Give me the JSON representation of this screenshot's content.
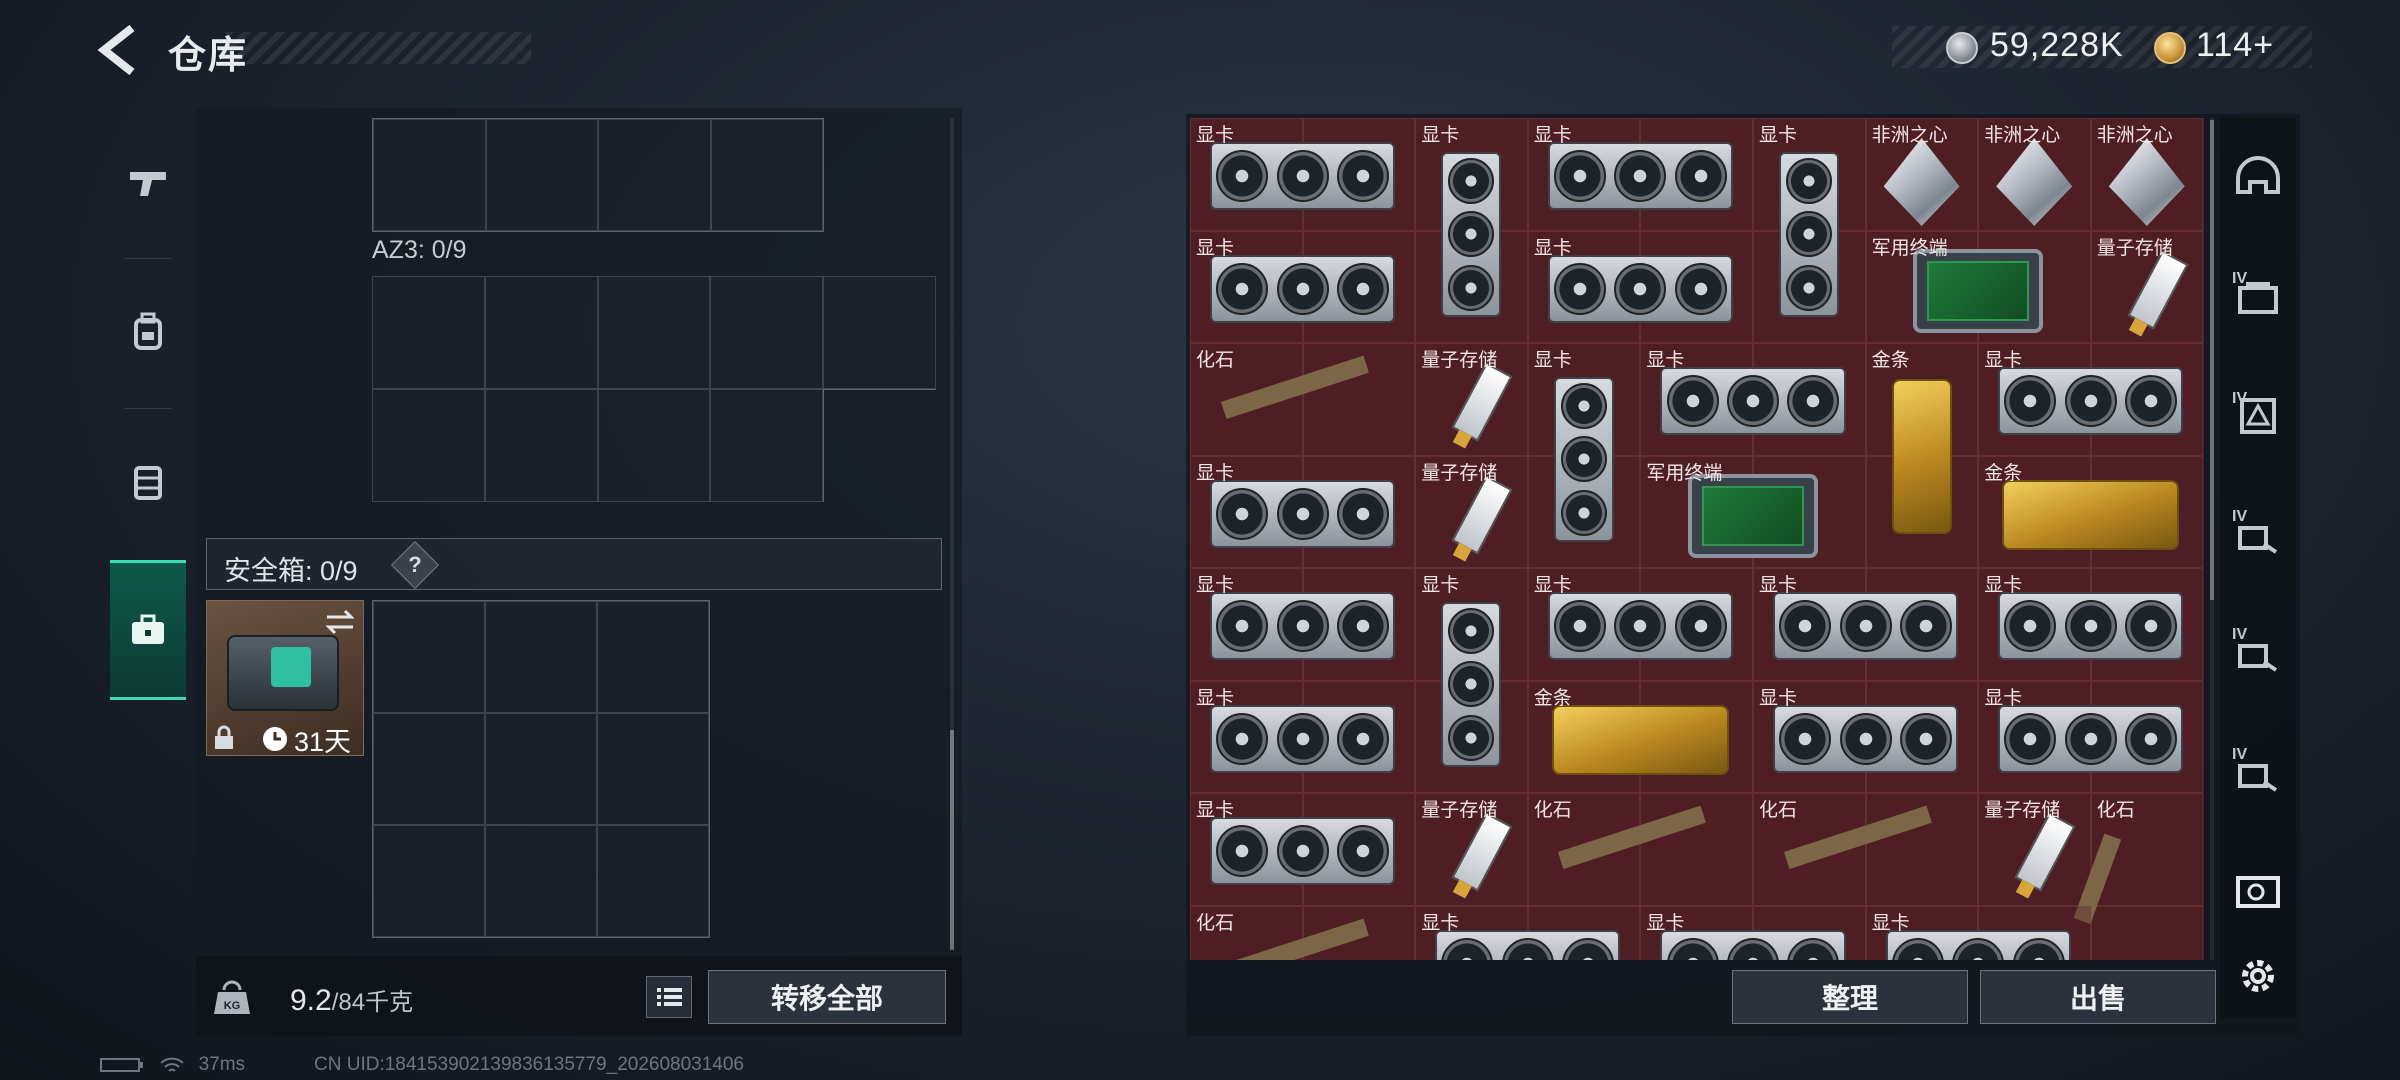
{
  "header": {
    "title": "仓库",
    "currency_silver": "59,228K",
    "currency_gold": "114+"
  },
  "left": {
    "az3_label": "AZ3: 0/9",
    "safe_label": "安全箱: 0/9",
    "safe_help": "?",
    "safebox_days": "31天",
    "weight_value": "9.2",
    "weight_max": "/84千克",
    "transfer_label": "转移全部"
  },
  "footer": {
    "ping": "37ms",
    "uid": "CN UID:1841539021398361357​79_202608031406"
  },
  "stash": {
    "items": [
      {
        "label": "显卡",
        "type": "gpu-h",
        "col": 0,
        "row": 0,
        "w": 2,
        "h": 1
      },
      {
        "label": "显卡",
        "type": "gpu-v",
        "col": 2,
        "row": 0,
        "w": 1,
        "h": 2
      },
      {
        "label": "显卡",
        "type": "gpu-h",
        "col": 3,
        "row": 0,
        "w": 2,
        "h": 1
      },
      {
        "label": "显卡",
        "type": "gpu-v",
        "col": 5,
        "row": 0,
        "w": 1,
        "h": 2
      },
      {
        "label": "非洲之心",
        "type": "diamond",
        "col": 6,
        "row": 0,
        "w": 1,
        "h": 1
      },
      {
        "label": "非洲之心",
        "type": "diamond",
        "col": 7,
        "row": 0,
        "w": 1,
        "h": 1
      },
      {
        "label": "非洲之心",
        "type": "diamond",
        "col": 8,
        "row": 0,
        "w": 1,
        "h": 1
      },
      {
        "label": "显卡",
        "type": "gpu-h",
        "col": 0,
        "row": 1,
        "w": 2,
        "h": 1
      },
      {
        "label": "显卡",
        "type": "gpu-h",
        "col": 3,
        "row": 1,
        "w": 2,
        "h": 1
      },
      {
        "label": "军用终端",
        "type": "terminal",
        "col": 6,
        "row": 1,
        "w": 2,
        "h": 1
      },
      {
        "label": "量子存储",
        "type": "usb",
        "col": 8,
        "row": 1,
        "w": 1,
        "h": 1
      },
      {
        "label": "化石",
        "type": "fossil",
        "col": 0,
        "row": 2,
        "w": 2,
        "h": 1
      },
      {
        "label": "量子存储",
        "type": "usb",
        "col": 2,
        "row": 2,
        "w": 1,
        "h": 1
      },
      {
        "label": "显卡",
        "type": "gpu-v",
        "col": 3,
        "row": 2,
        "w": 1,
        "h": 2
      },
      {
        "label": "显卡",
        "type": "gpu-h",
        "col": 4,
        "row": 2,
        "w": 2,
        "h": 1
      },
      {
        "label": "金条",
        "type": "gold-v",
        "col": 6,
        "row": 2,
        "w": 1,
        "h": 2
      },
      {
        "label": "显卡",
        "type": "gpu-h",
        "col": 7,
        "row": 2,
        "w": 2,
        "h": 1
      },
      {
        "label": "显卡",
        "type": "gpu-h",
        "col": 0,
        "row": 3,
        "w": 2,
        "h": 1
      },
      {
        "label": "量子存储",
        "type": "usb",
        "col": 2,
        "row": 3,
        "w": 1,
        "h": 1
      },
      {
        "label": "军用终端",
        "type": "terminal",
        "col": 4,
        "row": 3,
        "w": 2,
        "h": 1
      },
      {
        "label": "金条",
        "type": "gold-h",
        "col": 7,
        "row": 3,
        "w": 2,
        "h": 1
      },
      {
        "label": "显卡",
        "type": "gpu-h",
        "col": 0,
        "row": 4,
        "w": 2,
        "h": 1
      },
      {
        "label": "显卡",
        "type": "gpu-v",
        "col": 2,
        "row": 4,
        "w": 1,
        "h": 2
      },
      {
        "label": "显卡",
        "type": "gpu-h",
        "col": 3,
        "row": 4,
        "w": 2,
        "h": 1
      },
      {
        "label": "显卡",
        "type": "gpu-h",
        "col": 5,
        "row": 4,
        "w": 2,
        "h": 1
      },
      {
        "label": "显卡",
        "type": "gpu-h",
        "col": 7,
        "row": 4,
        "w": 2,
        "h": 1
      },
      {
        "label": "显卡",
        "type": "gpu-h",
        "col": 0,
        "row": 5,
        "w": 2,
        "h": 1
      },
      {
        "label": "金条",
        "type": "gold-h",
        "col": 3,
        "row": 5,
        "w": 2,
        "h": 1
      },
      {
        "label": "显卡",
        "type": "gpu-h",
        "col": 5,
        "row": 5,
        "w": 2,
        "h": 1
      },
      {
        "label": "显卡",
        "type": "gpu-h",
        "col": 7,
        "row": 5,
        "w": 2,
        "h": 1
      },
      {
        "label": "显卡",
        "type": "gpu-h",
        "col": 0,
        "row": 6,
        "w": 2,
        "h": 1
      },
      {
        "label": "量子存储",
        "type": "usb",
        "col": 2,
        "row": 6,
        "w": 1,
        "h": 1
      },
      {
        "label": "化石",
        "type": "fossil",
        "col": 3,
        "row": 6,
        "w": 2,
        "h": 1
      },
      {
        "label": "化石",
        "type": "fossil",
        "col": 5,
        "row": 6,
        "w": 2,
        "h": 1
      },
      {
        "label": "量子存储",
        "type": "usb",
        "col": 7,
        "row": 6,
        "w": 1,
        "h": 1
      },
      {
        "label": "化石",
        "type": "fossil-v",
        "col": 8,
        "row": 6,
        "w": 1,
        "h": 2
      },
      {
        "label": "化石",
        "type": "fossil",
        "col": 0,
        "row": 7,
        "w": 2,
        "h": 1
      },
      {
        "label": "显卡",
        "type": "gpu-h",
        "col": 2,
        "row": 7,
        "w": 2,
        "h": 1
      },
      {
        "label": "显卡",
        "type": "gpu-h",
        "col": 4,
        "row": 7,
        "w": 2,
        "h": 1
      },
      {
        "label": "显卡",
        "type": "gpu-h",
        "col": 6,
        "row": 7,
        "w": 2,
        "h": 1
      }
    ],
    "sort_label": "整理",
    "sell_label": "出售"
  },
  "icons": {
    "back": "back-arrow-icon",
    "tabs": [
      "gun-icon",
      "backpack-icon",
      "vest-icon",
      "safebox-icon"
    ],
    "right_tabs": [
      "helmet-icon",
      "ammo-box-icon",
      "armor-icon",
      "key-icon",
      "key-icon",
      "key-icon",
      "medkit-icon",
      "settings-icon"
    ]
  },
  "colors": {
    "accent": "#3fd8b0",
    "stash_bg": "#4a1e24"
  }
}
